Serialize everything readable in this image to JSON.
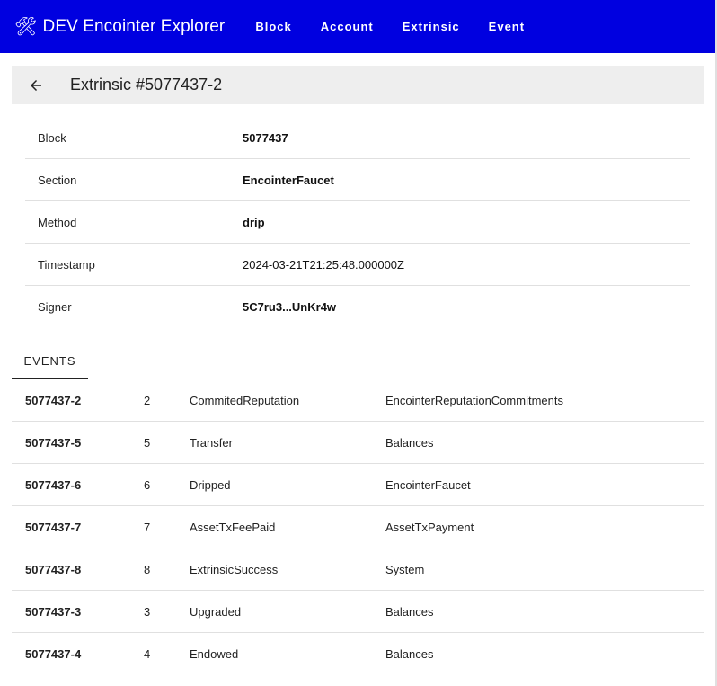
{
  "appbar": {
    "brand_icon": "🛠",
    "brand_title": "DEV Encointer Explorer",
    "nav": [
      {
        "label": "Block"
      },
      {
        "label": "Account"
      },
      {
        "label": "Extrinsic"
      },
      {
        "label": "Event"
      }
    ],
    "color": "#0000e0"
  },
  "titlebar": {
    "back_icon": "arrow-left-icon",
    "title": "Extrinsic #5077437-2"
  },
  "details": [
    {
      "label": "Block",
      "value": "5077437",
      "bold": true
    },
    {
      "label": "Section",
      "value": "EncointerFaucet",
      "bold": true
    },
    {
      "label": "Method",
      "value": "drip",
      "bold": true
    },
    {
      "label": "Timestamp",
      "value": "2024-03-21T21:25:48.000000Z",
      "bold": false
    },
    {
      "label": "Signer",
      "value": "5C7ru3...UnKr4w",
      "bold": true
    }
  ],
  "events_tab": {
    "label": "EVENTS"
  },
  "events": [
    {
      "id": "5077437-2",
      "index": "2",
      "method": "CommitedReputation",
      "section": "EncointerReputationCommitments"
    },
    {
      "id": "5077437-5",
      "index": "5",
      "method": "Transfer",
      "section": "Balances"
    },
    {
      "id": "5077437-6",
      "index": "6",
      "method": "Dripped",
      "section": "EncointerFaucet"
    },
    {
      "id": "5077437-7",
      "index": "7",
      "method": "AssetTxFeePaid",
      "section": "AssetTxPayment"
    },
    {
      "id": "5077437-8",
      "index": "8",
      "method": "ExtrinsicSuccess",
      "section": "System"
    },
    {
      "id": "5077437-3",
      "index": "3",
      "method": "Upgraded",
      "section": "Balances"
    },
    {
      "id": "5077437-4",
      "index": "4",
      "method": "Endowed",
      "section": "Balances"
    }
  ]
}
